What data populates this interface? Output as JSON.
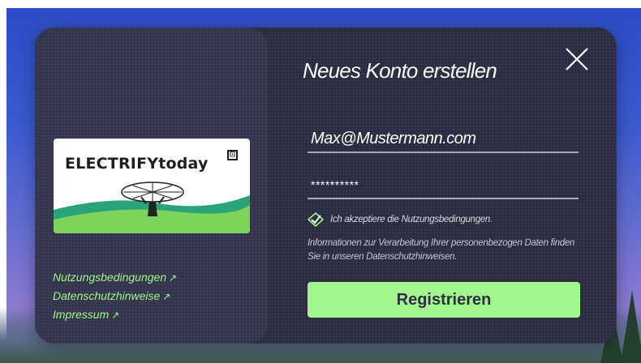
{
  "colors": {
    "accent": "#a3f590",
    "link": "#9ff58f",
    "modal_bg": "#2a2b3f",
    "panel_bg": "#34354a",
    "text": "#ffffff"
  },
  "dialog": {
    "title": "Neues Konto erstellen",
    "close_icon": "close-icon"
  },
  "form": {
    "email_value": "Max@Mustermann.com",
    "password_value": "**********",
    "terms_checked": true,
    "terms_label": "Ich akzeptiere die Nutzungsbedingungen.",
    "privacy_note": "Informationen zur Verarbeitung Ihrer personenbezogen Daten finden Sie in unseren Datenschutzhinweisen.",
    "submit_label": "Registrieren"
  },
  "brand": {
    "logo_text": "ELECTRIFYtoday",
    "badge_glyph": "⊡"
  },
  "links": [
    {
      "label": "Nutzungsbedingungen",
      "arrow": "↗"
    },
    {
      "label": "Datenschutzhinweise",
      "arrow": "↗"
    },
    {
      "label": "Impressum",
      "arrow": "↗"
    }
  ]
}
